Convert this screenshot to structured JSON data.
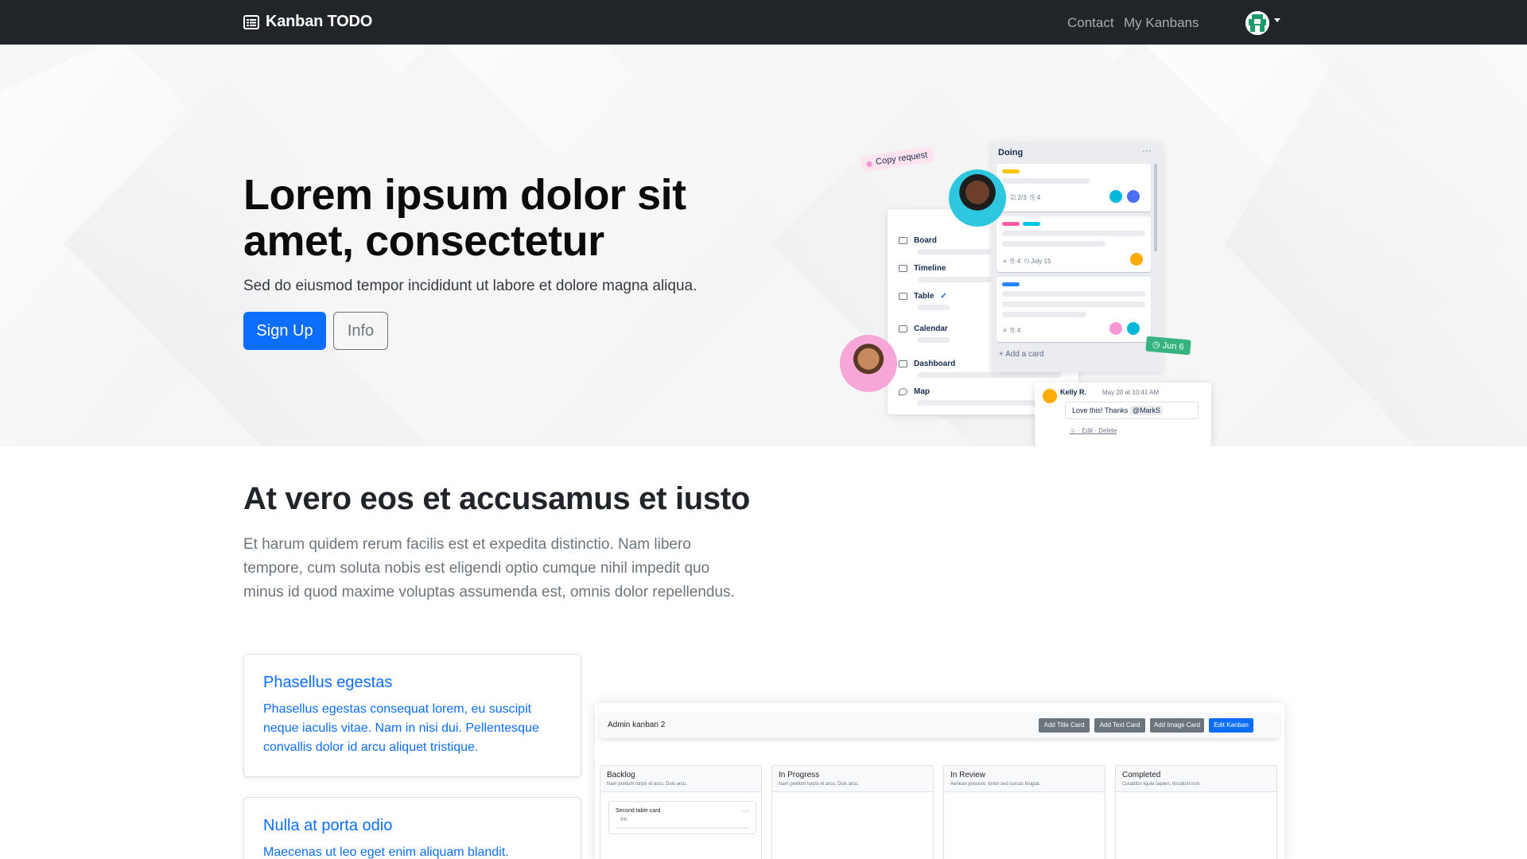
{
  "navbar": {
    "brand": "Kanban TODO",
    "links": [
      "Contact",
      "My Kanbans"
    ],
    "colors": {
      "background": "#212529"
    }
  },
  "hero": {
    "title": "Lorem ipsum dolor sit amet, consectetur",
    "subtitle": "Sed do eiusmod tempor incididunt ut labore et dolore magna aliqua.",
    "signup_label": "Sign Up",
    "info_label": "Info",
    "illustration": {
      "copy_tag": "Copy request",
      "views": [
        "Board",
        "Timeline",
        "Table",
        "Calendar",
        "Dashboard",
        "Map"
      ],
      "column_title": "Doing",
      "column_menu": "···",
      "card1_meta": "2/3",
      "card1_attach": "4",
      "card2_attach": "4",
      "card2_date": "July 15",
      "card3_attach": "4",
      "add_card": "+ Add a card",
      "date_tag": "Jun 6",
      "comment": {
        "author": "Kelly R.",
        "date": "May 20 at 10:41 AM",
        "text": "Love this! Thanks",
        "mention": "@MarkS",
        "edit": "Edit",
        "delete": "Delete"
      }
    }
  },
  "section": {
    "title": "At vero eos et accusamus et iusto",
    "text": "Et harum quidem rerum facilis est et expedita distinctio. Nam libero tempore, cum soluta nobis est eligendi optio cumque nihil impedit quo minus id quod maxime voluptas assumenda est, omnis dolor repellendus."
  },
  "features": [
    {
      "title": "Phasellus egestas",
      "text": "Phasellus egestas consequat lorem, eu suscipit neque iaculis vitae. Nam in nisi dui. Pellentesque convallis dolor id arcu aliquet tristique."
    },
    {
      "title": "Nulla at porta odio",
      "text": "Maecenas ut leo eget enim aliquam blandit."
    }
  ],
  "preview": {
    "kanban_name": "Admin kanban 2",
    "buttons": [
      "Add Title Card",
      "Add Text Card",
      "Add Image Card",
      "Edit Kanban"
    ],
    "columns": [
      {
        "title": "Backlog",
        "subtitle": "Nam pretium turpis et arcu. Duis arcu."
      },
      {
        "title": "In Progress",
        "subtitle": "Nam pretium turpis et arcu. Duis arcu."
      },
      {
        "title": "In Review",
        "subtitle": "Aenean posuere, tortor sed cursus feugiat."
      },
      {
        "title": "Completed",
        "subtitle": "Curabitur ligula sapien, tincidunt non."
      }
    ],
    "card": {
      "title": "Second table card",
      "progress": "0%"
    }
  },
  "colors": {
    "primary": "#0d6efd",
    "secondary": "#6c757d"
  }
}
